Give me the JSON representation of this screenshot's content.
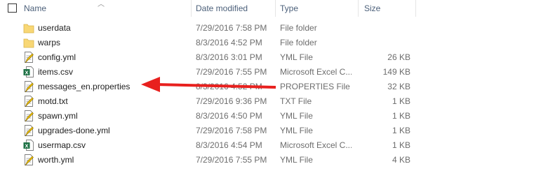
{
  "columns": {
    "name": "Name",
    "date": "Date modified",
    "type": "Type",
    "size": "Size"
  },
  "rows": [
    {
      "name": "userdata",
      "date": "7/29/2016 7:58 PM",
      "type": "File folder",
      "size": "",
      "icon": "folder-icon"
    },
    {
      "name": "warps",
      "date": "8/3/2016 4:52 PM",
      "type": "File folder",
      "size": "",
      "icon": "folder-icon"
    },
    {
      "name": "config.yml",
      "date": "8/3/2016 3:01 PM",
      "type": "YML File",
      "size": "26 KB",
      "icon": "text-file-icon"
    },
    {
      "name": "items.csv",
      "date": "7/29/2016 7:55 PM",
      "type": "Microsoft Excel C...",
      "size": "149 KB",
      "icon": "excel-file-icon"
    },
    {
      "name": "messages_en.properties",
      "date": "8/3/2016 4:52 PM",
      "type": "PROPERTIES File",
      "size": "32 KB",
      "icon": "text-file-icon"
    },
    {
      "name": "motd.txt",
      "date": "7/29/2016 9:36 PM",
      "type": "TXT File",
      "size": "1 KB",
      "icon": "text-file-icon"
    },
    {
      "name": "spawn.yml",
      "date": "8/3/2016 4:50 PM",
      "type": "YML File",
      "size": "1 KB",
      "icon": "text-file-icon"
    },
    {
      "name": "upgrades-done.yml",
      "date": "7/29/2016 7:58 PM",
      "type": "YML File",
      "size": "1 KB",
      "icon": "text-file-icon"
    },
    {
      "name": "usermap.csv",
      "date": "8/3/2016 4:54 PM",
      "type": "Microsoft Excel C...",
      "size": "1 KB",
      "icon": "excel-file-icon"
    },
    {
      "name": "worth.yml",
      "date": "7/29/2016 7:55 PM",
      "type": "YML File",
      "size": "4 KB",
      "icon": "text-file-icon"
    }
  ],
  "annotation": {
    "icon": "red-arrow-icon",
    "color": "#e8201e"
  },
  "colors": {
    "folder": "#f8d775",
    "excel": "#1e7145",
    "header_text": "#4c607a",
    "muted_text": "#6d6d6d"
  }
}
